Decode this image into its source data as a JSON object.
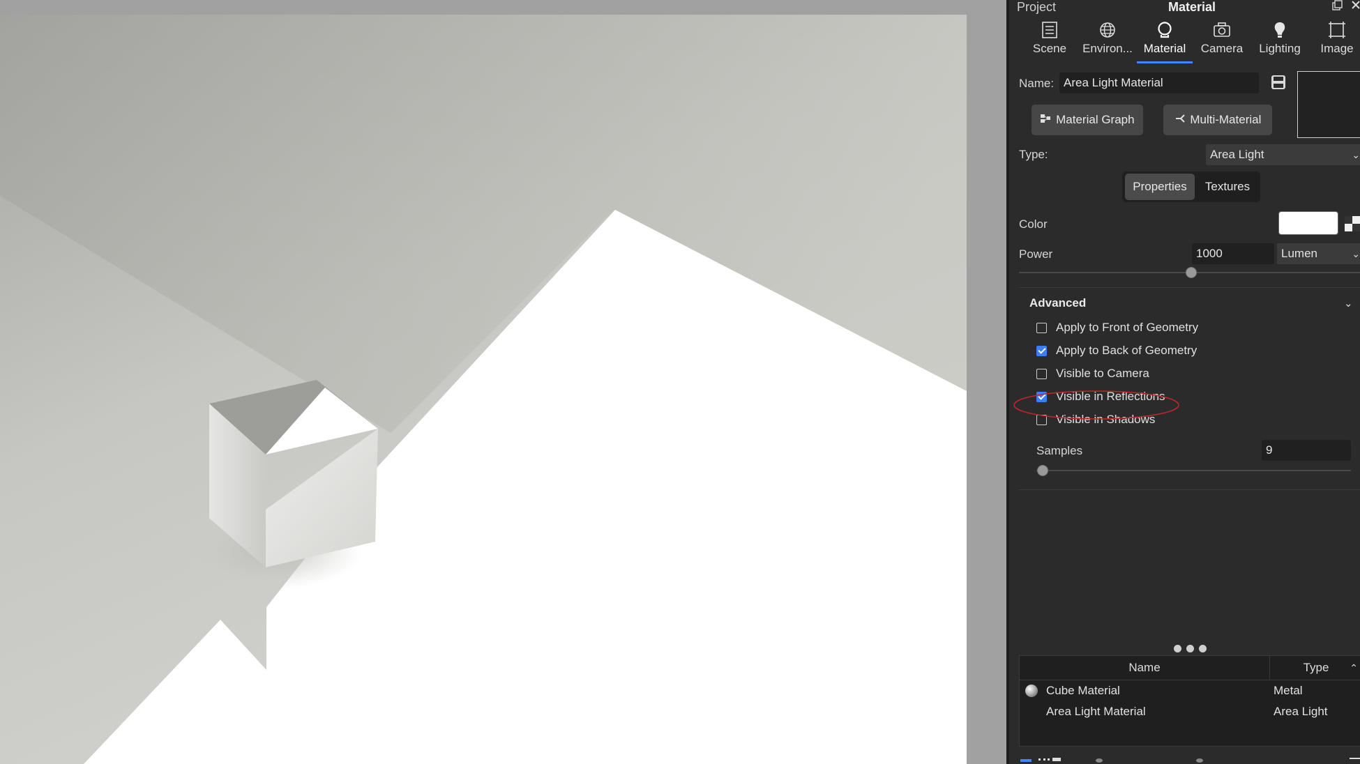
{
  "panel": {
    "title_left": "Project",
    "title_center": "Material",
    "tabs": [
      {
        "label": "Scene",
        "icon": "scene-list-icon"
      },
      {
        "label": "Environ...",
        "icon": "globe-icon"
      },
      {
        "label": "Material",
        "icon": "material-sphere-icon"
      },
      {
        "label": "Camera",
        "icon": "camera-icon"
      },
      {
        "label": "Lighting",
        "icon": "lightbulb-icon"
      },
      {
        "label": "Image",
        "icon": "image-frame-icon"
      }
    ],
    "active_tab": "Material",
    "name_label": "Name:",
    "name_value": "Area Light Material",
    "material_graph_label": "Material Graph",
    "multi_material_label": "Multi-Material",
    "type_label": "Type:",
    "type_value": "Area Light",
    "segments": [
      "Properties",
      "Textures"
    ],
    "active_segment": "Properties",
    "color_label": "Color",
    "color_value": "#ffffff",
    "power_label": "Power",
    "power_value": "1000",
    "power_unit": "Lumen",
    "power_slider_fraction": 0.5,
    "advanced_label": "Advanced",
    "options": [
      {
        "label": "Apply to Front of Geometry",
        "checked": false
      },
      {
        "label": "Apply to Back of Geometry",
        "checked": true
      },
      {
        "label": "Visible to Camera",
        "checked": false
      },
      {
        "label": "Visible in Reflections",
        "checked": true
      },
      {
        "label": "Visible in Shadows",
        "checked": false
      }
    ],
    "highlighted_option": "Visible in Reflections",
    "samples_label": "Samples",
    "samples_value": "9",
    "samples_slider_fraction": 0.02,
    "table": {
      "headers": [
        "Name",
        "Type"
      ],
      "rows": [
        {
          "name": "Cube Material",
          "type": "Metal",
          "icon": "metal-sphere-icon"
        },
        {
          "name": "Area Light Material",
          "type": "Area Light",
          "icon": ""
        }
      ]
    }
  },
  "colors": {
    "accent": "#3f86ff",
    "panel_bg": "#2b2b2b",
    "highlight_ellipse": "#c0262c"
  }
}
